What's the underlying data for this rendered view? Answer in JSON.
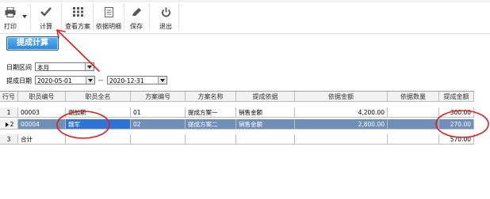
{
  "toolbar": {
    "buttons": [
      {
        "label": "打印",
        "icon": "printer-icon"
      },
      {
        "label": "计算",
        "icon": "checkmark-icon"
      },
      {
        "label": "查看方案",
        "icon": "grid-icon"
      },
      {
        "label": "依据明细",
        "icon": "document-icon"
      },
      {
        "label": "保存",
        "icon": "pencil-icon"
      },
      {
        "label": "退出",
        "icon": "power-icon"
      }
    ]
  },
  "title": "提成计算",
  "filters": {
    "date_range_label": "日期区间",
    "date_range_value": "本月",
    "commission_date_label": "提成日期",
    "start_date": "2020-05-01",
    "separator": "--",
    "end_date": "2020-12-31"
  },
  "table": {
    "columns": [
      "行号",
      "职员编号",
      "职员全名",
      "方案编号",
      "方案名称",
      "提成依据",
      "依据金额",
      "依据数量",
      "提成金额"
    ],
    "rows": [
      {
        "no": "1",
        "emp_id": "00003",
        "emp_name": "谢加斯",
        "plan_id": "01",
        "plan_name": "提成方案一",
        "basis": "销售金额",
        "basis_amount": "4,200.00",
        "basis_qty": "",
        "commission": "300.00"
      },
      {
        "no": "2",
        "emp_id": "00004",
        "emp_name": "魏军",
        "plan_id": "02",
        "plan_name": "提成方案二",
        "basis": "销售金额",
        "basis_amount": "2,800.00",
        "basis_qty": "",
        "commission": "270.00"
      },
      {
        "no": "3",
        "emp_id": "合计",
        "emp_name": "",
        "plan_id": "",
        "plan_name": "",
        "basis": "",
        "basis_amount": "",
        "basis_qty": "",
        "commission": "570.00"
      }
    ]
  },
  "colors": {
    "title_button": "#2b86d9",
    "selected_row": "#6f8fb9",
    "active_cell": "#2e74d6",
    "annotation_red": "#e02020"
  }
}
